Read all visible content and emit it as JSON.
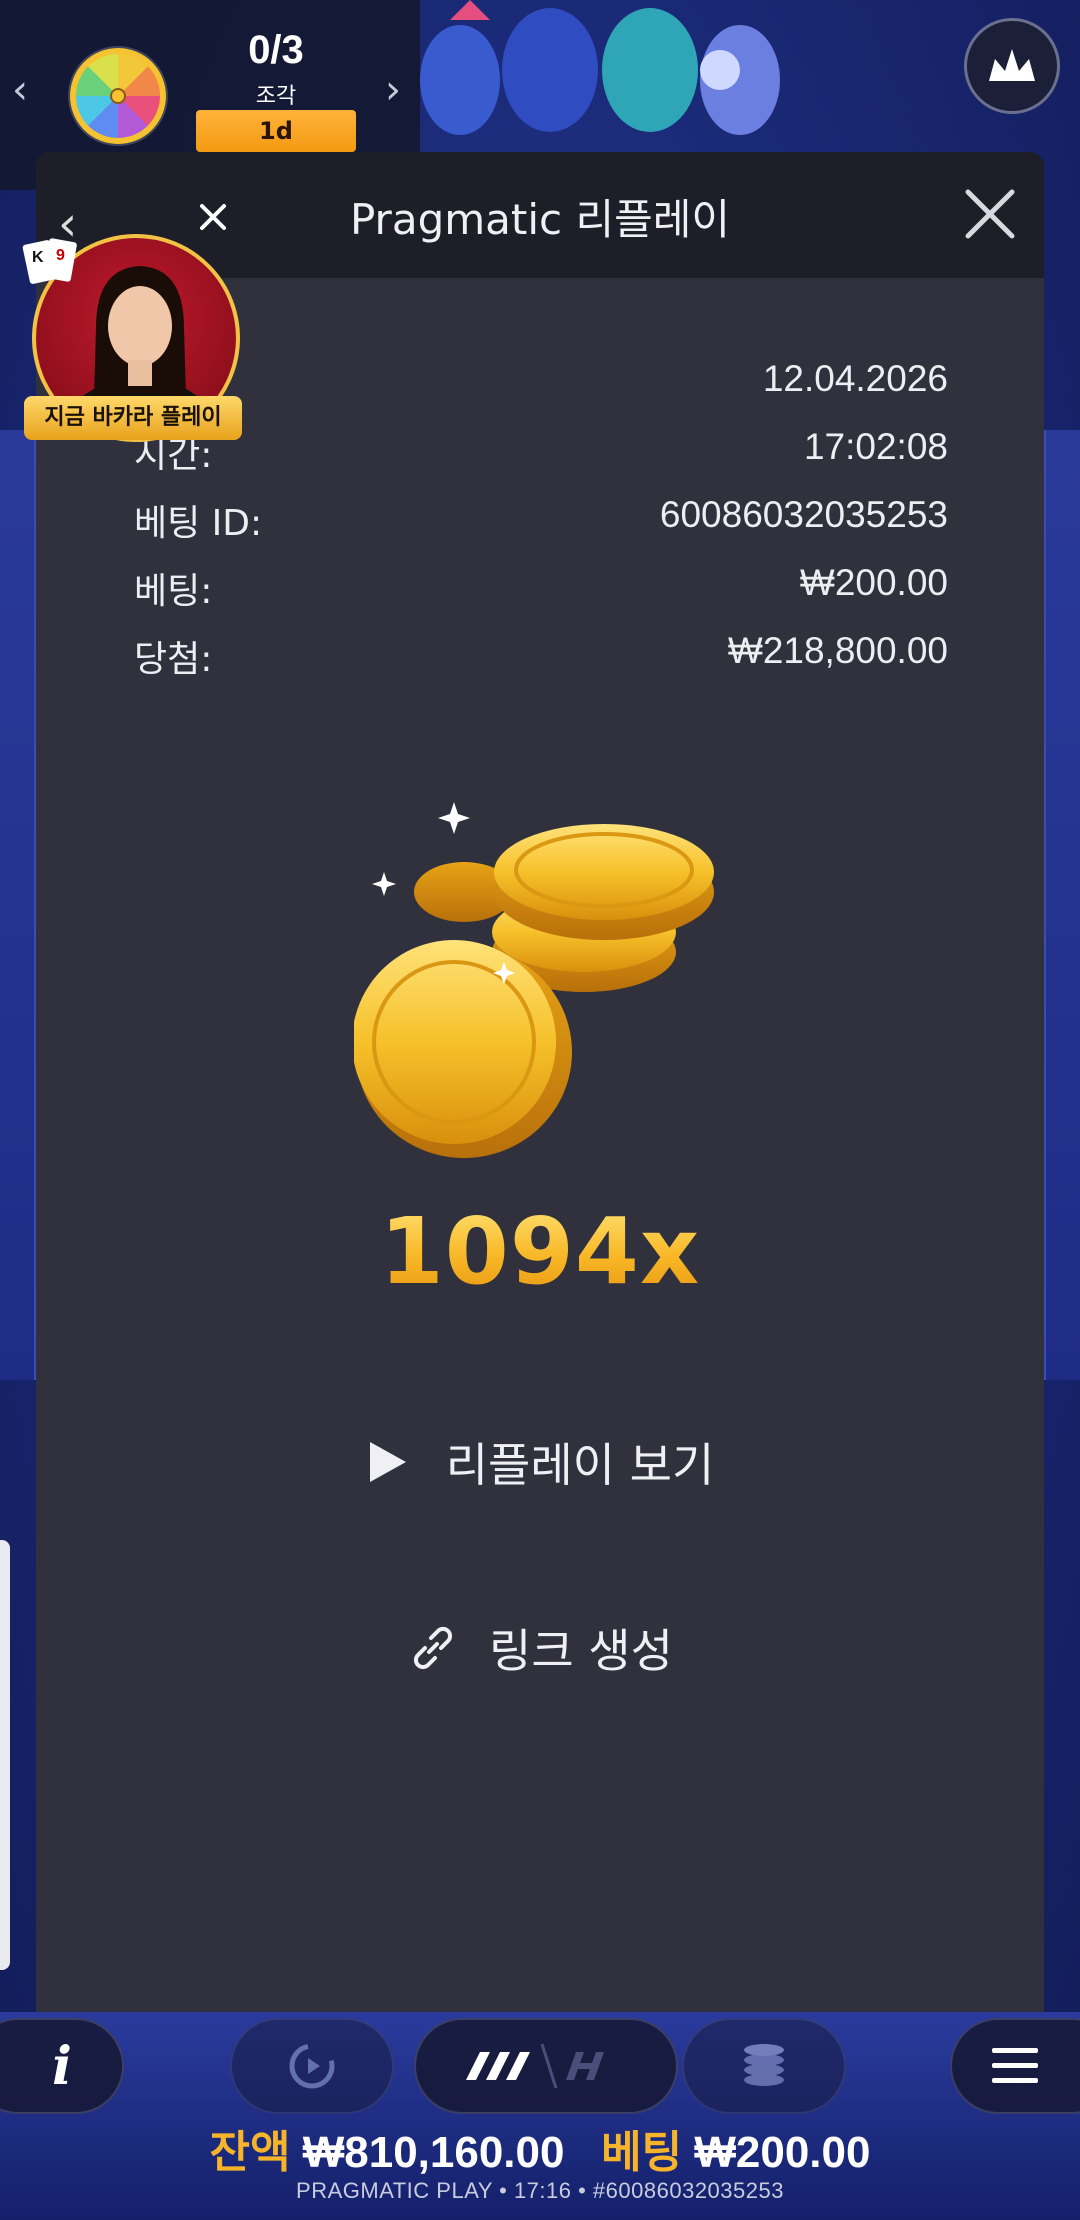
{
  "event": {
    "count": "0/3",
    "pieces_label": "조각",
    "timer": "1d",
    "prev_icon": "chevron-left-icon",
    "next_icon": "chevron-right-icon",
    "wheel_icon": "prize-wheel-icon"
  },
  "header": {
    "title": "Pragmatic 리플레이",
    "close_icon": "close-icon",
    "crown_icon": "crown-icon"
  },
  "promo": {
    "label": "지금 바카라 플레이"
  },
  "details": [
    {
      "label": "",
      "value": "12.04.2026"
    },
    {
      "label": "시간:",
      "value": "17:02:08"
    },
    {
      "label": "베팅 ID:",
      "value": "60086032035253"
    },
    {
      "label": "베팅:",
      "value": "₩200.00"
    },
    {
      "label": "당첨:",
      "value": "₩218,800.00"
    }
  ],
  "win": {
    "multiplier": "1094x"
  },
  "actions": {
    "replay_label": "리플레이 보기",
    "link_label": "링크 생성"
  },
  "bottom": {
    "balance_label": "잔액",
    "balance_value": "₩810,160.00",
    "bet_label": "베팅",
    "bet_value": "₩200.00",
    "footer": "PRAGMATIC PLAY • 17:16 • #60086032035253"
  },
  "colors": {
    "accent_gold": "#f5b429",
    "modal_bg": "#30313d",
    "header_bg": "#1d1e27"
  }
}
